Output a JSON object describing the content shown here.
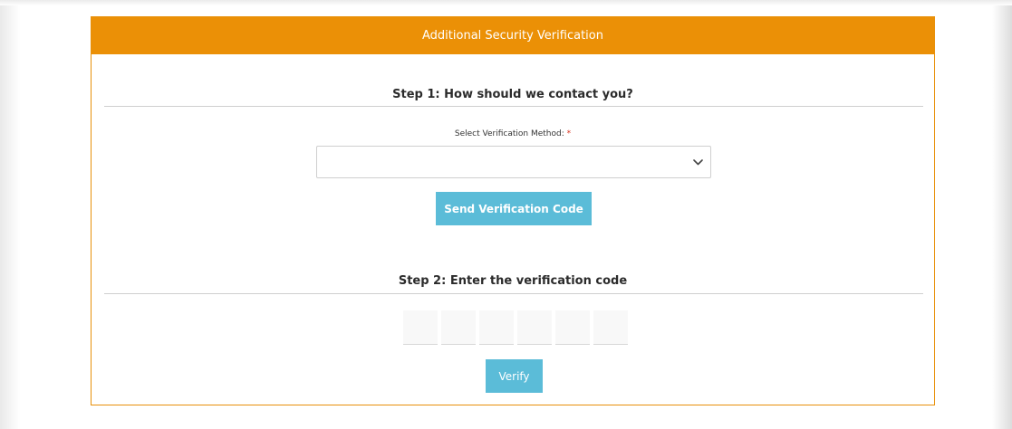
{
  "header": {
    "title": "Additional Security Verification"
  },
  "step1": {
    "title": "Step 1: How should we contact you?",
    "field_label": "Select Verification Method:",
    "required_mark": "*",
    "selected_value": "",
    "send_button_label": "Send Verification Code"
  },
  "step2": {
    "title": "Step 2: Enter the verification code",
    "code_digits": [
      "",
      "",
      "",
      "",
      "",
      ""
    ],
    "verify_button_label": "Verify"
  },
  "colors": {
    "header_orange": "#eb9006",
    "button_blue": "#5bbcd8",
    "required_red": "#d9301c"
  },
  "icons": {
    "select_indicator": "chevron-down-icon"
  }
}
